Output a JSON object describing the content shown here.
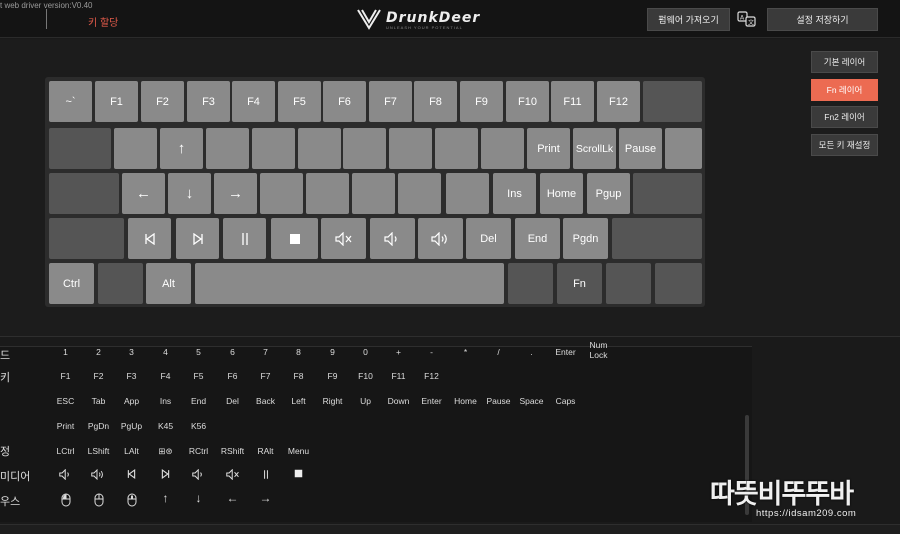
{
  "header": {
    "version": "t web driver version:V0.40",
    "active_tab": "키 할당",
    "brand": "DrunkDeer",
    "tagline": "UNLEASH YOUR POTENTIAL",
    "import_button": "펌웨어 가져오기",
    "save_button": "설정 저장하기"
  },
  "layers": [
    "기본 레이어",
    "Fn 레이어",
    "Fn2 레이어",
    "모든 키 재설정"
  ],
  "active_layer": "Fn 레이어",
  "keyboard": {
    "row1": [
      "~`",
      "F1",
      "F2",
      "F3",
      "F4",
      "F5",
      "F6",
      "F7",
      "F8",
      "F9",
      "F10",
      "F11",
      "F12",
      ""
    ],
    "row2": [
      "",
      "",
      "↑",
      "",
      "",
      "",
      "",
      "",
      "",
      "",
      "Print",
      "ScrollLk",
      "Pause",
      ""
    ],
    "row3": [
      "",
      "←",
      "↓",
      "→",
      "",
      "",
      "",
      "",
      "",
      "Ins",
      "Home",
      "Pgup",
      ""
    ],
    "row4": [
      "",
      "prev-track",
      "next-track",
      "play-pause",
      "stop",
      "mute",
      "volume-down",
      "volume-up",
      "Del",
      "End",
      "Pgdn",
      ""
    ],
    "row5": [
      "Ctrl",
      "",
      "Alt",
      "",
      "",
      "Fn",
      "",
      ""
    ]
  },
  "palette": {
    "rows": [
      {
        "label": "드",
        "items": [
          "1",
          "2",
          "3",
          "4",
          "5",
          "6",
          "7",
          "8",
          "9",
          "0",
          "+",
          "-",
          "*",
          "/",
          ".",
          "Enter",
          "Num\nLock"
        ]
      },
      {
        "label": "키",
        "items": [
          "F1",
          "F2",
          "F3",
          "F4",
          "F5",
          "F6",
          "F7",
          "F8",
          "F9",
          "F10",
          "F11",
          "F12"
        ]
      },
      {
        "label": "",
        "items": [
          "ESC",
          "Tab",
          "App",
          "Ins",
          "End",
          "Del",
          "Back",
          "Left",
          "Right",
          "Up",
          "Down",
          "Enter",
          "Home",
          "Pause",
          "Space",
          "Caps"
        ]
      },
      {
        "label": "",
        "items": [
          "Print",
          "PgDn",
          "PgUp",
          "K45",
          "K56"
        ]
      },
      {
        "label": "정",
        "items": [
          "LCtrl",
          "LShift",
          "LAlt",
          "⊞⊛",
          "RCtrl",
          "RShift",
          "RAlt",
          "Menu"
        ]
      },
      {
        "label": "미디어",
        "items": [
          "volume-down-icon",
          "volume-up-icon",
          "prev-track-icon",
          "next-track-icon",
          "volume-down-icon",
          "mute-icon",
          "play-pause-icon",
          "stop-icon"
        ]
      },
      {
        "label": "우스",
        "items": [
          "mouse-left-icon",
          "mouse-right-icon",
          "mouse-middle-icon",
          "arrow-up-icon",
          "arrow-down-icon",
          "arrow-left-icon",
          "arrow-right-icon"
        ]
      }
    ]
  },
  "watermark": {
    "big": "따뜻비뚜뚜바",
    "url": "https://idsam209.com"
  },
  "colors": {
    "accent": "#ec6b52",
    "key": "#8a8a8a",
    "key_dark": "#555555",
    "background": "#1a1a1a"
  }
}
